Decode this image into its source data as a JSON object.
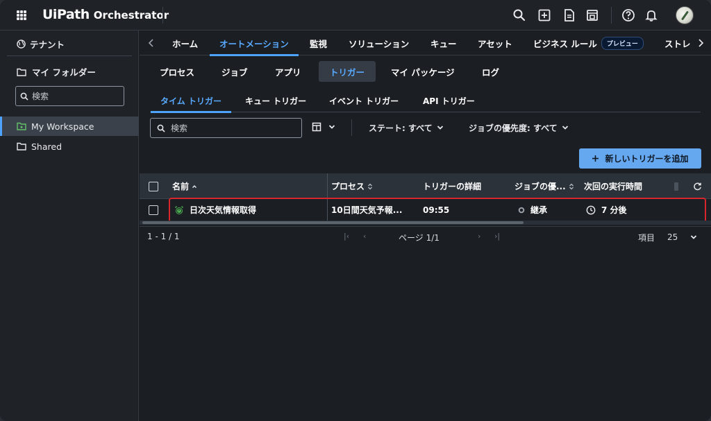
{
  "header": {
    "brand": "UiPath",
    "product": "Orchestrator",
    "icons": [
      "search-icon",
      "add-box-icon",
      "document-icon",
      "robot-icon",
      "help-icon",
      "bell-icon"
    ]
  },
  "sidebar": {
    "tenant_label": "テナント",
    "my_folder_label": "マイ フォルダー",
    "search_placeholder": "検索",
    "items": [
      {
        "label": "My Workspace",
        "active": true
      },
      {
        "label": "Shared",
        "active": false
      }
    ]
  },
  "main_tabs": [
    "ホーム",
    "オートメーション",
    "監視",
    "ソリューション",
    "キュー",
    "アセット",
    "ビジネス ルール",
    "ストレ"
  ],
  "preview_badge": "プレビュー",
  "automation_tabs": [
    "プロセス",
    "ジョブ",
    "アプリ",
    "トリガー",
    "マイ パッケージ",
    "ログ"
  ],
  "trigger_tabs": [
    "タイム トリガー",
    "キュー トリガー",
    "イベント トリガー",
    "API トリガー"
  ],
  "toolbar": {
    "search_placeholder": "検索",
    "state_filter": "ステート: すべて",
    "priority_filter": "ジョブの優先度: すべて",
    "add_button": "新しいトリガーを追加"
  },
  "table": {
    "headers": [
      "名前",
      "プロセス",
      "トリガーの詳細",
      "ジョブの優...",
      "次回の実行時間"
    ],
    "rows": [
      {
        "name": "日次天気情報取得",
        "process": "10日間天気予報...",
        "details": "09:55",
        "priority": "継承",
        "next_run": "7 分後"
      }
    ]
  },
  "pager": {
    "range": "1 - 1 / 1",
    "page": "ページ 1/1",
    "items_label": "項目",
    "page_size": "25"
  },
  "colors": {
    "accent": "#4da3ff",
    "highlight": "#d8262c",
    "button": "#66a8f0"
  }
}
